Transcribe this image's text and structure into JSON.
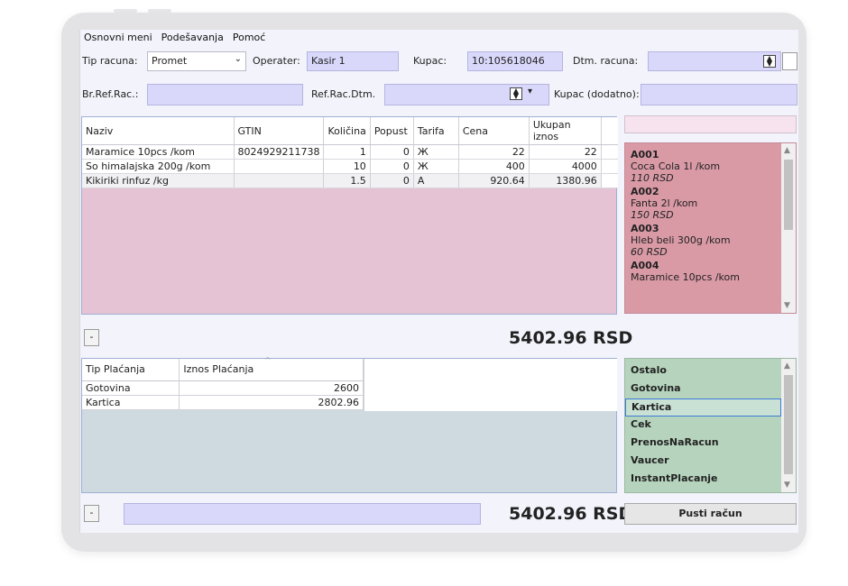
{
  "menu": [
    "Osnovni meni",
    "Podešavanja",
    "Pomoć"
  ],
  "header": {
    "tip_racuna_label": "Tip racuna:",
    "tip_racuna_value": "Promet",
    "operater_label": "Operater:",
    "operater_value": "Kasir 1",
    "kupac_label": "Kupac:",
    "kupac_value": "10:105618046",
    "dtm_racuna_label": "Dtm. racuna:",
    "br_ref_label": "Br.Ref.Rac.:",
    "ref_dtm_label": "Ref.Rac.Dtm.",
    "kupac_dodatno_label": "Kupac (dodatno):"
  },
  "items_table": {
    "columns": [
      "Naziv",
      "GTIN",
      "Količina",
      "Popust",
      "Tarifa",
      "Cena",
      "Ukupan iznos"
    ],
    "rows": [
      [
        "Maramice 10pcs /kom",
        "8024929211738",
        "1",
        "0",
        "Ж",
        "22",
        "22"
      ],
      [
        "So himalajska 200g /kom",
        "",
        "10",
        "0",
        "Ж",
        "400",
        "4000"
      ],
      [
        "Kikiriki rinfuz /kg",
        "",
        "1.5",
        "0",
        "A",
        "920.64",
        "1380.96"
      ]
    ]
  },
  "products": [
    {
      "code": "A001",
      "name": "Coca Cola 1l /kom",
      "price": "110 RSD"
    },
    {
      "code": "A002",
      "name": "Fanta 2l /kom",
      "price": "150 RSD"
    },
    {
      "code": "A003",
      "name": "Hleb beli 300g /kom",
      "price": "60 RSD"
    },
    {
      "code": "A004",
      "name": "Maramice 10pcs /kom",
      "price": ""
    }
  ],
  "minus_label": "-",
  "total_items": "5402.96 RSD",
  "payments_table": {
    "columns": [
      "Tip Plaćanja",
      "Iznos Plaćanja"
    ],
    "rows": [
      [
        "Gotovina",
        "2600"
      ],
      [
        "Kartica",
        "2802.96"
      ]
    ]
  },
  "payment_types": [
    "Ostalo",
    "Gotovina",
    "Kartica",
    "Cek",
    "PrenosNaRacun",
    "Vaucer",
    "InstantPlacanje"
  ],
  "selected_payment_type": "Kartica",
  "total_payments": "5402.96 RSD",
  "pusti_label": "Pusti račun",
  "icons": {
    "dropdown": "chevron-down-icon",
    "spinner": "spinner-icon",
    "scroll_up": "scroll-up-icon",
    "scroll_down": "scroll-down-icon",
    "sort": "sort-icon"
  },
  "colors": {
    "field_bg": "#d9d8fb",
    "items_bg": "#e5c3d4",
    "products_bg": "#d99aa6",
    "payments_bg": "#cedae0",
    "paytypes_bg": "#b6d4bd",
    "selection": "#3a7bd5"
  }
}
